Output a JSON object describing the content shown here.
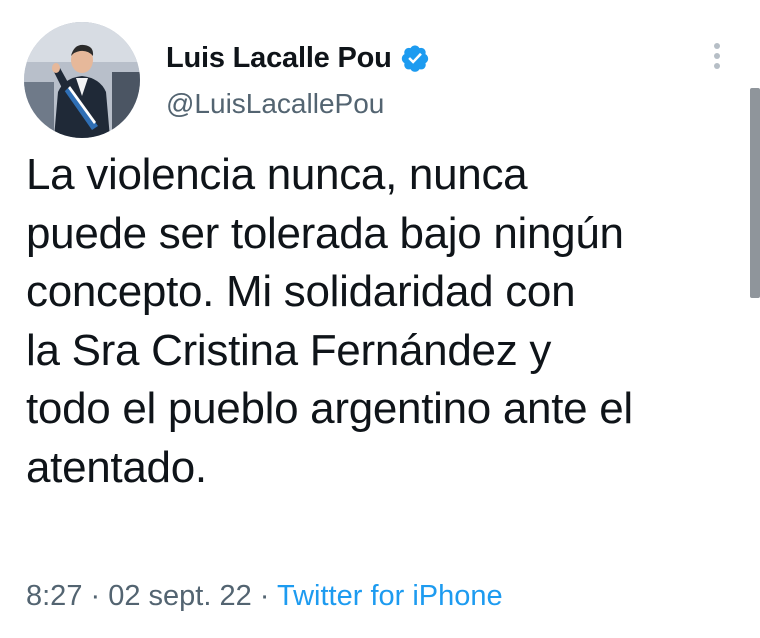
{
  "author": {
    "display_name": "Luis Lacalle Pou",
    "handle": "@LuisLacallePou",
    "verified": true,
    "avatar_icon": "profile-photo",
    "verified_icon": "verified-badge-icon"
  },
  "tweet": {
    "text": "La violencia nunca, nunca\npuede ser tolerada bajo ningún\nconcepto. Mi solidaridad con\nla Sra Cristina Fernández y\ntodo el pueblo argentino ante el\natentado."
  },
  "meta": {
    "time": "8:27",
    "separator": " · ",
    "date": "02 sept. 22",
    "source": "Twitter for iPhone"
  },
  "controls": {
    "more_icon": "more-vertical-icon"
  },
  "colors": {
    "text_primary": "#0f1419",
    "text_secondary": "#536471",
    "accent": "#1d9bf0",
    "background": "#ffffff"
  }
}
